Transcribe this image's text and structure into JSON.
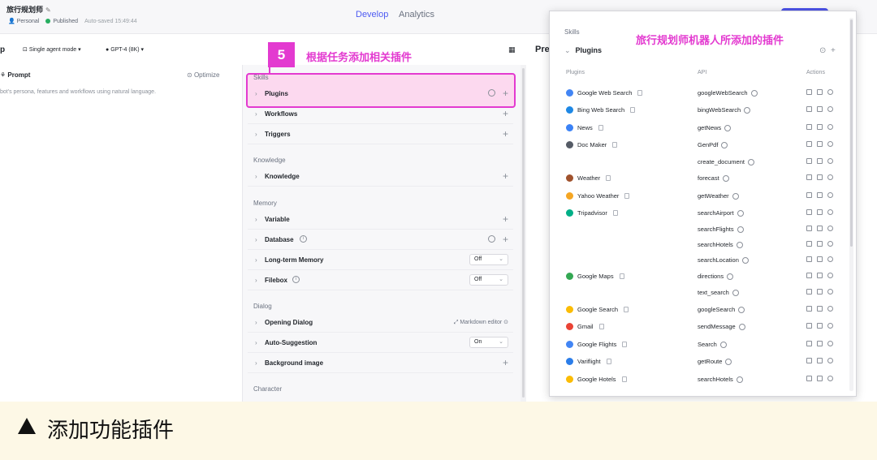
{
  "header": {
    "title": "旅行规划师",
    "personal": "Personal",
    "published": "Published",
    "autosave": "Auto-saved 15:49:44",
    "tabs": [
      "Develop",
      "Analytics"
    ]
  },
  "subbar": {
    "left_fragment": "p",
    "mode": "Single agent mode",
    "model": "GPT-4 (8K)"
  },
  "prompt": {
    "title": "Prompt",
    "optimize": "Optimize",
    "placeholder": "bot's persona, features and workflows using natural language."
  },
  "skills": {
    "section_skills": "Skills",
    "plugins": "Plugins",
    "workflows": "Workflows",
    "triggers": "Triggers",
    "section_knowledge": "Knowledge",
    "knowledge": "Knowledge",
    "section_memory": "Memory",
    "variable": "Variable",
    "database": "Database",
    "long_term_memory": "Long-term Memory",
    "long_term_memory_value": "Off",
    "filebox": "Filebox",
    "filebox_value": "Off",
    "section_dialog": "Dialog",
    "opening_dialog": "Opening Dialog",
    "markdown_editor": "Markdown editor",
    "auto_suggestion": "Auto-Suggestion",
    "auto_suggestion_value": "On",
    "background_image": "Background image",
    "section_character": "Character"
  },
  "callout": {
    "step": "5",
    "text": "根据任务添加相关插件"
  },
  "preview": {
    "label": "Pre"
  },
  "popup": {
    "skills": "Skills",
    "annotation": "旅行规划师机器人所添加的插件",
    "plugins_title": "Plugins",
    "headers": {
      "plugins": "Plugins",
      "api": "API",
      "actions": "Actions"
    },
    "rows": [
      {
        "plugin": "Google Web Search",
        "api": "googleWebSearch",
        "color": "#4285f4"
      },
      {
        "plugin": "Bing Web Search",
        "api": "bingWebSearch",
        "color": "#1e88e5"
      },
      {
        "plugin": "News",
        "api": "getNews",
        "color": "#3b82f6"
      },
      {
        "plugin": "Doc Maker",
        "api": "GenPdf",
        "color": "#555b66"
      },
      {
        "plugin": "",
        "api": "create_document",
        "color": ""
      },
      {
        "plugin": "Weather",
        "api": "forecast",
        "color": "#a0522d"
      },
      {
        "plugin": "Yahoo Weather",
        "api": "getWeather",
        "color": "#f5a623"
      },
      {
        "plugin": "Tripadvisor",
        "api": "searchAirport",
        "color": "#00af87"
      },
      {
        "plugin": "",
        "api": "searchFlights",
        "color": ""
      },
      {
        "plugin": "",
        "api": "searchHotels",
        "color": ""
      },
      {
        "plugin": "",
        "api": "searchLocation",
        "color": ""
      },
      {
        "plugin": "Google Maps",
        "api": "directions",
        "color": "#34a853"
      },
      {
        "plugin": "",
        "api": "text_search",
        "color": ""
      },
      {
        "plugin": "Google Search",
        "api": "googleSearch",
        "color": "#fbbc05"
      },
      {
        "plugin": "Gmail",
        "api": "sendMessage",
        "color": "#ea4335"
      },
      {
        "plugin": "Google Flights",
        "api": "Search",
        "color": "#4285f4"
      },
      {
        "plugin": "Variflight",
        "api": "getRoute",
        "color": "#2b7de9"
      },
      {
        "plugin": "Google Hotels",
        "api": "searchHotels",
        "color": "#fbbc05"
      }
    ]
  },
  "caption": {
    "text": "添加功能插件"
  }
}
